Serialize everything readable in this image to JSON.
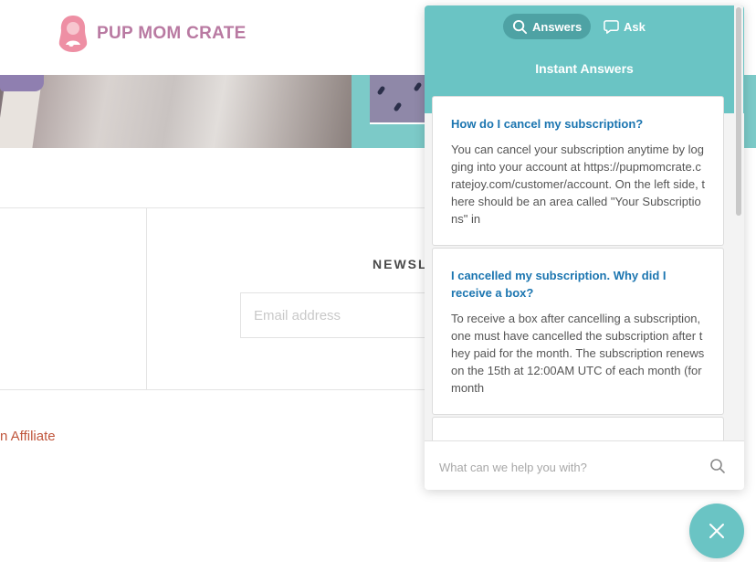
{
  "site": {
    "brand_name": "PUP MOM CRATE",
    "newsletter_title": "NEWSL",
    "email_placeholder": "Email address",
    "affiliate_link": "n Affiliate"
  },
  "colors": {
    "brand_pink": "#b97aa2",
    "widget_teal": "#6ac4c4",
    "active_tab": "#4ea2a4",
    "link_blue": "#1b75b0",
    "affiliate_red": "#c0563c"
  },
  "widget": {
    "tabs": [
      {
        "label": "Answers",
        "icon": "search-icon",
        "active": true
      },
      {
        "label": "Ask",
        "icon": "chat-bubble-icon",
        "active": false
      }
    ],
    "header_title": "Instant Answers",
    "articles": [
      {
        "title": "How do I cancel my subscription?",
        "excerpt": "You can cancel your subscription anytime by logging into your account at https://pupmomcrate.cratejoy.com/customer/account. On the left side, there should be an area called \"Your Subscriptions\" in"
      },
      {
        "title": "I cancelled my subscription. Why did I receive a box?",
        "excerpt": "To receive a box after cancelling a subscription, one must have cancelled the subscription after they paid for the month. The subscription renews on the 15th at 12:00AM UTC of each month (for month"
      }
    ],
    "search_placeholder": "What can we help you with?",
    "search_icon": "search-icon",
    "close_icon": "close-icon"
  }
}
